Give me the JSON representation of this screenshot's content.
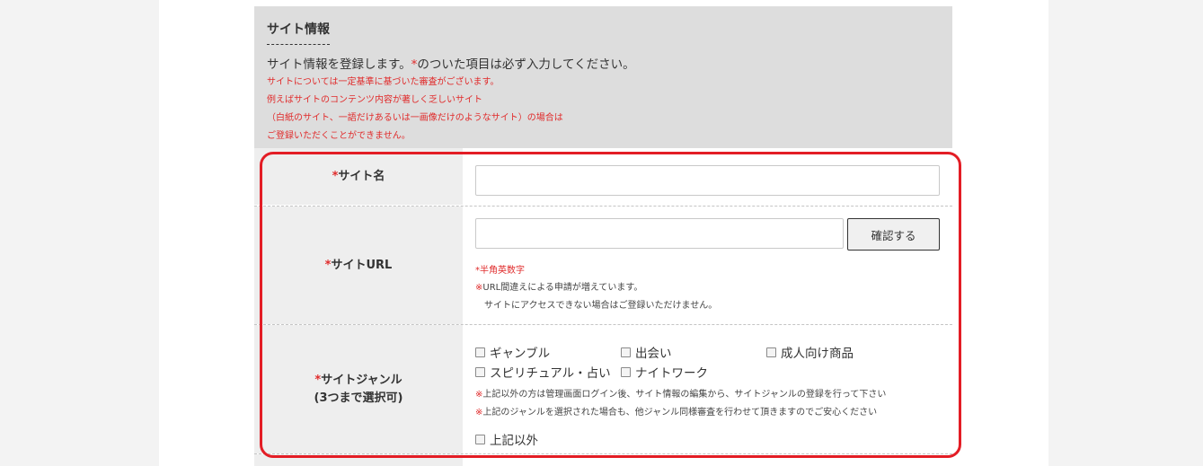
{
  "section": {
    "title": "サイト情報",
    "intro_before": "サイト情報を登録します。",
    "intro_mark": "*",
    "intro_after": "のついた項目は必ず入力してください。",
    "notices": [
      "サイトについては一定基準に基づいた審査がございます。",
      "例えばサイトのコンテンツ内容が著しく乏しいサイト",
      "（白紙のサイト、一語だけあるいは一画像だけのようなサイト）の場合は",
      "ご登録いただくことができません。"
    ]
  },
  "form": {
    "required_mark": "*",
    "site_name": {
      "label": "サイト名",
      "value": "",
      "placeholder": ""
    },
    "site_url": {
      "label": "サイトURL",
      "value": "",
      "placeholder": "",
      "confirm_button": "確認する",
      "hint": "*半角英数字",
      "note_mark": "※",
      "note_line1": "URL間違えによる申請が増えています。",
      "note_line2": "サイトにアクセスできない場合はご登録いただけません。"
    },
    "site_genre": {
      "label": "サイトジャンル",
      "sublabel": "(3つまで選択可)",
      "options": [
        "ギャンブル",
        "出会い",
        "成人向け商品",
        "スピリチュアル・占い",
        "ナイトワーク"
      ],
      "note_mark": "※",
      "note_line1": "上記以外の方は管理画面ログイン後、サイト情報の編集から、サイトジャンルの登録を行って下さい",
      "note_line2": "上記のジャンルを選択された場合も、他ジャンル同様審査を行わせて頂きますのでご安心ください",
      "other_option": "上記以外"
    }
  },
  "colors": {
    "required": "#e02b2b",
    "highlight_border": "#e31d25",
    "panel_bg": "#dddddd",
    "label_bg": "#eeeeee"
  }
}
